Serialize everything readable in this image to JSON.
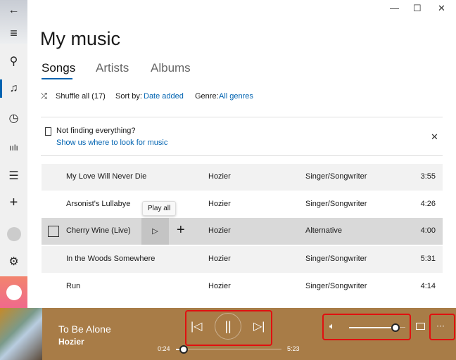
{
  "window": {
    "back": "←",
    "minimize": "—",
    "maximize": "☐",
    "close": "✕"
  },
  "sidebar": {
    "items": [
      "menu",
      "search",
      "music",
      "recent",
      "now-playing",
      "playlists",
      "add",
      "account",
      "settings",
      "spotify"
    ]
  },
  "header": {
    "title": "My music",
    "tabs": [
      "Songs",
      "Artists",
      "Albums"
    ],
    "active_tab": "Songs"
  },
  "toolbar": {
    "shuffle": "Shuffle all (17)",
    "sort_label": "Sort by:",
    "sort_value": "Date added",
    "genre_label": "Genre:",
    "genre_value": "All genres"
  },
  "notice": {
    "text": "Not finding everything?",
    "link": "Show us where to look for music"
  },
  "songs": [
    {
      "title": "My Love Will Never Die",
      "artist": "Hozier",
      "genre": "Singer/Songwriter",
      "duration": "3:55"
    },
    {
      "title": "Arsonist's Lullabye",
      "artist": "Hozier",
      "genre": "Singer/Songwriter",
      "duration": "4:26"
    },
    {
      "title": "Cherry Wine (Live)",
      "artist": "Hozier",
      "genre": "Alternative",
      "duration": "4:00"
    },
    {
      "title": "In the Woods Somewhere",
      "artist": "Hozier",
      "genre": "Singer/Songwriter",
      "duration": "5:31"
    },
    {
      "title": "Run",
      "artist": "Hozier",
      "genre": "Singer/Songwriter",
      "duration": "4:14"
    }
  ],
  "tooltip": "Play all",
  "player": {
    "title": "To Be Alone",
    "artist": "Hozier",
    "elapsed": "0:24",
    "total": "5:23",
    "progress": 0.074,
    "volume": 0.83,
    "more": "···",
    "bar_color": "#a87c47"
  }
}
